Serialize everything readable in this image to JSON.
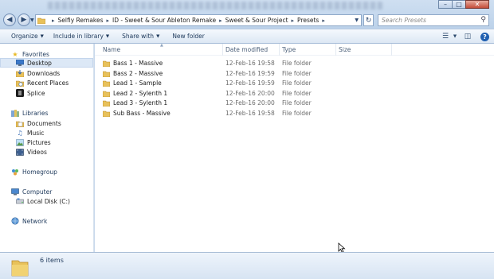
{
  "window": {
    "controls": [
      "minimize",
      "maximize",
      "close"
    ]
  },
  "address": {
    "breadcrumbs": [
      "Selfiy Remakes",
      "ID - Sweet & Sour Ableton Remake",
      "Sweet & Sour Project",
      "Presets"
    ]
  },
  "search": {
    "placeholder": "Search Presets"
  },
  "toolbar": {
    "organize": "Organize",
    "include_in_library": "Include in library",
    "share_with": "Share with",
    "new_folder": "New folder"
  },
  "nav": {
    "favorites": "Favorites",
    "desktop": "Desktop",
    "downloads": "Downloads",
    "recent_places": "Recent Places",
    "splice": "Splice",
    "libraries": "Libraries",
    "documents": "Documents",
    "music": "Music",
    "pictures": "Pictures",
    "videos": "Videos",
    "homegroup": "Homegroup",
    "computer": "Computer",
    "local_disk": "Local Disk (C:)",
    "network": "Network"
  },
  "columns": {
    "name": "Name",
    "date_modified": "Date modified",
    "type": "Type",
    "size": "Size"
  },
  "files": [
    {
      "name": "Bass 1 - Massive",
      "date": "12-Feb-16 19:58",
      "type": "File folder",
      "size": ""
    },
    {
      "name": "Bass 2 - Massive",
      "date": "12-Feb-16 19:59",
      "type": "File folder",
      "size": ""
    },
    {
      "name": "Lead 1 - Sample",
      "date": "12-Feb-16 19:59",
      "type": "File folder",
      "size": ""
    },
    {
      "name": "Lead 2 - Sylenth 1",
      "date": "12-Feb-16 20:00",
      "type": "File folder",
      "size": ""
    },
    {
      "name": "Lead 3 - Sylenth 1",
      "date": "12-Feb-16 20:00",
      "type": "File folder",
      "size": ""
    },
    {
      "name": "Sub Bass - Massive",
      "date": "12-Feb-16 19:58",
      "type": "File folder",
      "size": ""
    }
  ],
  "status": {
    "item_count": "6 items"
  },
  "colors": {
    "folder": "#e8c15a",
    "folder_dark": "#c99a2e",
    "selection": "#dce8f6",
    "chrome": "#c9d9ec"
  }
}
